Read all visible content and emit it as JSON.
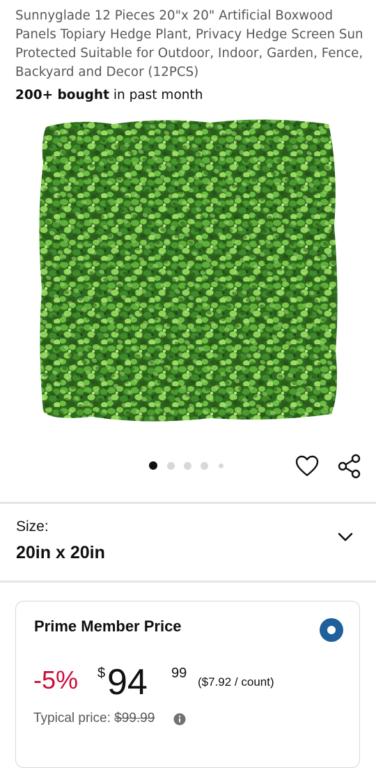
{
  "product": {
    "title": "Sunnyglade 12 Pieces 20\"x 20\" Artificial Boxwood Panels Topiary Hedge Plant, Privacy Hedge Screen Sun Protected Suitable for Outdoor, Indoor, Garden, Fence, Backyard and Decor (12PCS)",
    "bought_bold": "200+ bought",
    "bought_rest": " in past month"
  },
  "gallery": {
    "image_count": 5,
    "active_index": 0,
    "icons": [
      "heart-icon",
      "share-icon"
    ]
  },
  "size": {
    "label": "Size:",
    "value": "20in x 20in"
  },
  "offer": {
    "title": "Prime Member Price",
    "selected": true,
    "discount": "-5%",
    "currency": "$",
    "price_whole": "94",
    "price_fraction": "99",
    "unit_price": "($7.92 / count)",
    "typical_label": "Typical price: ",
    "typical_price": "$99.99"
  },
  "colors": {
    "accent_blue": "#1f5f9b",
    "discount_red": "#cc0c39",
    "leaf_green": "#3f8a2a"
  }
}
